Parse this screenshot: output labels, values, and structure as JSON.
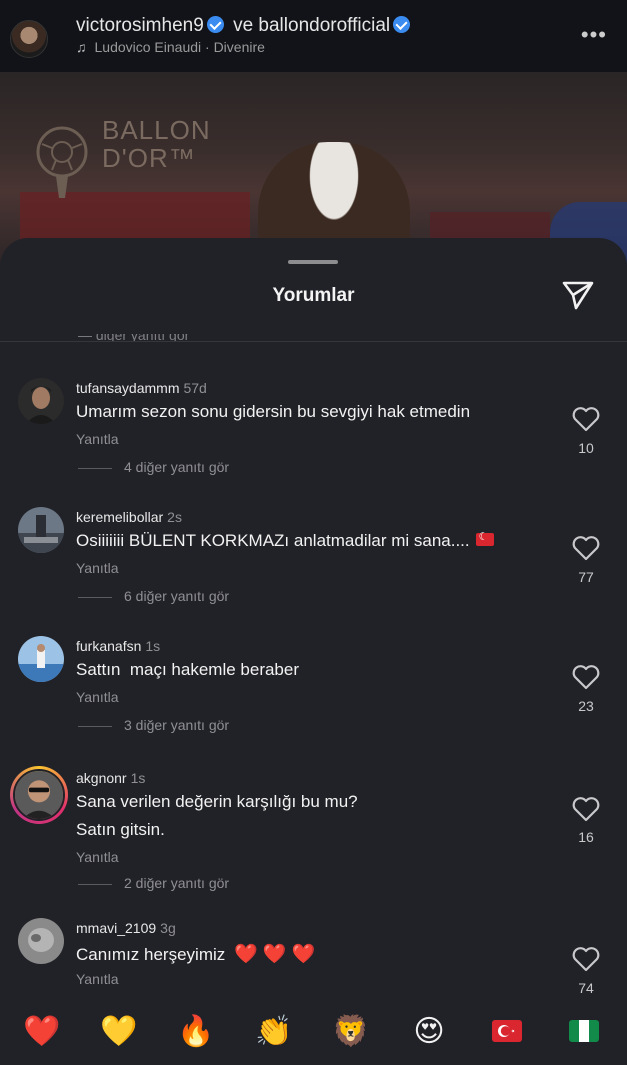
{
  "header": {
    "user1": "victorosimhen9",
    "connector": "ve",
    "user2": "ballondorofficial",
    "music": "Ludovico Einaudi · Divenire",
    "more_icon": "more-horizontal-icon"
  },
  "video": {
    "logo_text_line1": "BALLON",
    "logo_text_line2": "D'OR™"
  },
  "sheet": {
    "title": "Yorumlar",
    "cut_text": "— diğer yanıtı gör"
  },
  "comments": [
    {
      "user": "tufansaydammm",
      "time": "57d",
      "lines": [
        "Umarım sezon sonu gidersin bu sevgiyi hak etmedin"
      ],
      "reply": "Yanıtla",
      "more": "4 diğer yanıtı gör",
      "likes": "10"
    },
    {
      "user": "keremelibollar",
      "time": "2s",
      "lines": [
        "Osiiiiiii BÜLENT KORKMAZı anlatmadilar mi sana...."
      ],
      "emoji": "flag-turkey",
      "reply": "Yanıtla",
      "more": "6 diğer yanıtı gör",
      "likes": "77"
    },
    {
      "user": "furkanafsn",
      "time": "1s",
      "lines": [
        "Sattın  maçı hakemle beraber"
      ],
      "reply": "Yanıtla",
      "more": "3 diğer yanıtı gör",
      "likes": "23"
    },
    {
      "user": "akgnonr",
      "time": "1s",
      "lines": [
        "Sana verilen değerin karşılığı bu mu?",
        "Satın gitsin."
      ],
      "reply": "Yanıtla",
      "more": "2 diğer yanıtı gör",
      "likes": "16"
    },
    {
      "user": "mmavi_2109",
      "time": "3g",
      "lines": [
        "Canımız herşeyimiz"
      ],
      "hearts": "❤️ ❤️ ❤️",
      "reply": "Yanıtla",
      "likes": "74"
    }
  ],
  "emoji_bar": [
    "❤️",
    "💛",
    "🔥",
    "👏",
    "🦁",
    "😍",
    "flag-turkey",
    "flag-nigeria"
  ],
  "colors": {
    "background": "#212227",
    "verified": "#3b8cf0",
    "accent_red": "#e0242c"
  }
}
